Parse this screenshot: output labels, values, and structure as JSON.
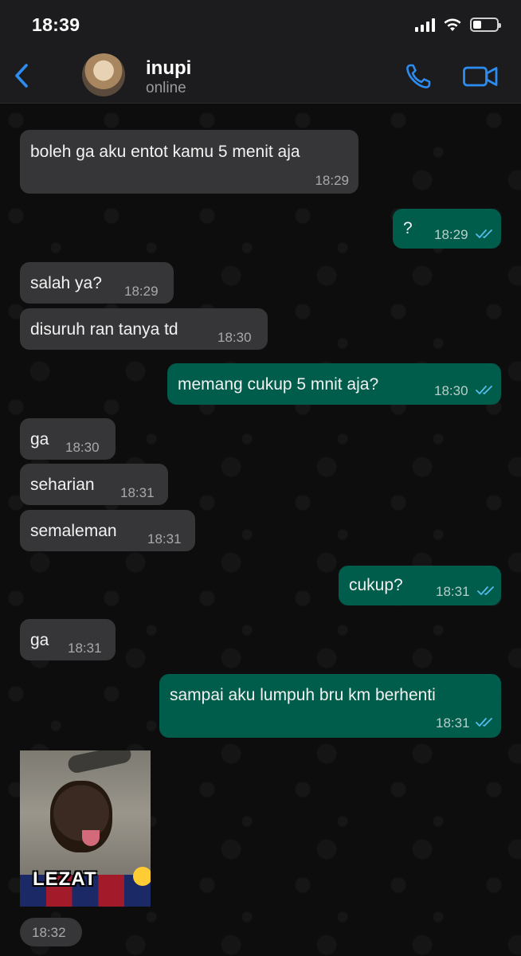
{
  "status_bar": {
    "time": "18:39",
    "battery_level": 0.35
  },
  "header": {
    "back_icon": "chevron-left-icon",
    "contact_name": "inupi",
    "contact_status": "online",
    "call_icon": "phone-icon",
    "video_icon": "video-camera-icon",
    "accent_color": "#2d8cf0"
  },
  "messages": [
    {
      "direction": "in",
      "text": "boleh ga aku entot kamu 5 menit aja",
      "time": "18:29"
    },
    {
      "direction": "out",
      "text": "?",
      "time": "18:29",
      "read": true
    },
    {
      "direction": "in",
      "text": "salah ya?",
      "time": "18:29"
    },
    {
      "direction": "in",
      "text": "disuruh ran tanya td",
      "time": "18:30"
    },
    {
      "direction": "out",
      "text": "memang cukup 5 mnit aja?",
      "time": "18:30",
      "read": true
    },
    {
      "direction": "in",
      "text": "ga",
      "time": "18:30"
    },
    {
      "direction": "in",
      "text": "seharian",
      "time": "18:31"
    },
    {
      "direction": "in",
      "text": "semaleman",
      "time": "18:31"
    },
    {
      "direction": "out",
      "text": "cukup?",
      "time": "18:31",
      "read": true
    },
    {
      "direction": "in",
      "text": "ga",
      "time": "18:31"
    },
    {
      "direction": "out",
      "text": "sampai aku lumpuh bru km berhenti",
      "time": "18:31",
      "read": true
    }
  ],
  "sticker": {
    "caption": "LEZAT",
    "time": "18:32"
  },
  "colors": {
    "incoming_bubble": "#363638",
    "outgoing_bubble": "#005c4b",
    "read_ticks": "#53bdeb"
  }
}
